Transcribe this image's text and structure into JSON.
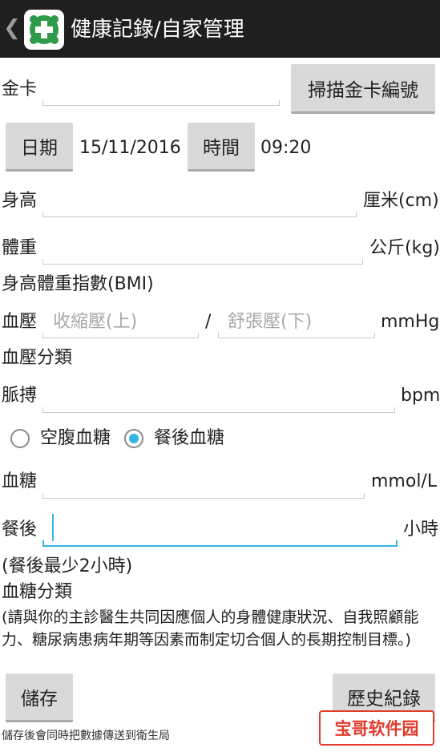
{
  "header": {
    "back_glyph": "❮",
    "title": "健康記錄/自家管理"
  },
  "gold_card": {
    "label": "金卡",
    "value": "",
    "scan_button": "掃描金卡編號"
  },
  "datetime": {
    "date_button": "日期",
    "date_value": "15/11/2016",
    "time_button": "時間",
    "time_value": "09:20"
  },
  "height": {
    "label": "身高",
    "value": "",
    "unit": "厘米(cm)"
  },
  "weight": {
    "label": "體重",
    "value": "",
    "unit": "公斤(kg)"
  },
  "bmi": {
    "label": "身高體重指數(BMI)"
  },
  "blood_pressure": {
    "label": "血壓",
    "systolic_placeholder": "收縮壓(上)",
    "separator": "/",
    "diastolic_placeholder": "舒張壓(下)",
    "unit": "mmHg",
    "category_label": "血壓分類"
  },
  "pulse": {
    "label": "脈搏",
    "value": "",
    "unit": "bpm"
  },
  "glucose_type": {
    "options": [
      {
        "label": "空腹血糖",
        "selected": false
      },
      {
        "label": "餐後血糖",
        "selected": true
      }
    ]
  },
  "glucose": {
    "label": "血糖",
    "value": "",
    "unit": "mmol/L"
  },
  "post_meal": {
    "label": "餐後",
    "value": "",
    "unit": "小時",
    "note": "(餐後最少2小時)"
  },
  "glucose_category": {
    "label": "血糖分類",
    "advice": "(請與你的主診醫生共同因應個人的身體健康狀況、自我照顧能力、糖尿病患病年期等因素而制定切合個人的長期控制目標。)"
  },
  "actions": {
    "save_button": "儲存",
    "history_button": "歷史紀錄"
  },
  "footer_note": "儲存後會同時把數據傳送到衛生局",
  "watermark_text": "宝哥软件园",
  "colors": {
    "accent": "#33b5e5",
    "logo_green": "#2e9a4a",
    "header_bg": "#1f1f1f",
    "button_bg": "#d9d9d9"
  }
}
